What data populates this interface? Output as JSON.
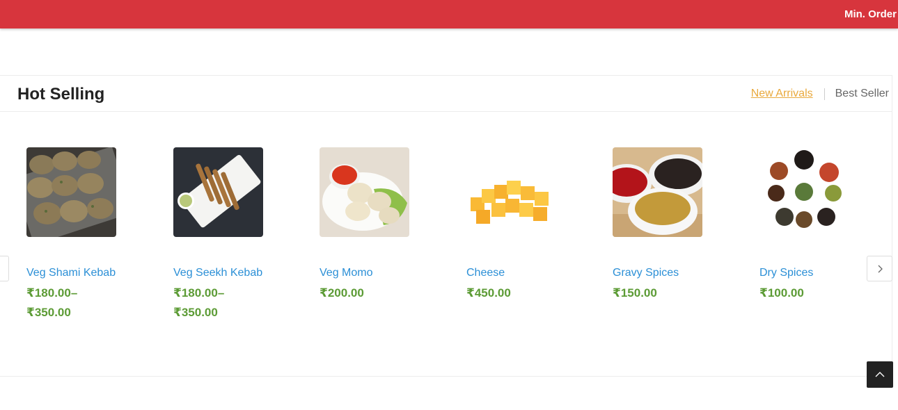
{
  "topbar": {
    "text": "Min. Order"
  },
  "section": {
    "title": "Hot Selling",
    "tabs": [
      {
        "label": "New Arrivals",
        "active": true
      },
      {
        "label": "Best Seller",
        "active": false
      }
    ]
  },
  "products": [
    {
      "name": "Veg Shami Kebab",
      "price_line1": "₹180.00–",
      "price_line2": "₹350.00",
      "image": "veg-shami-kebab"
    },
    {
      "name": "Veg Seekh Kebab",
      "price_line1": "₹180.00–",
      "price_line2": "₹350.00",
      "image": "veg-seekh-kebab"
    },
    {
      "name": "Veg Momo",
      "price_line1": "₹200.00",
      "price_line2": "",
      "image": "veg-momo"
    },
    {
      "name": "Cheese",
      "price_line1": "₹450.00",
      "price_line2": "",
      "image": "cheese"
    },
    {
      "name": "Gravy Spices",
      "price_line1": "₹150.00",
      "price_line2": "",
      "image": "gravy-spices"
    },
    {
      "name": "Dry Spices",
      "price_line1": "₹100.00",
      "price_line2": "",
      "image": "dry-spices"
    }
  ],
  "colors": {
    "topbar": "#d7353d",
    "accent_tab": "#e9a93c",
    "product_name": "#2b8fd6",
    "price": "#5c9b35"
  },
  "icons": {
    "prev": "chevron-left-icon",
    "next": "chevron-right-icon",
    "scroll_top": "chevron-up-icon"
  }
}
